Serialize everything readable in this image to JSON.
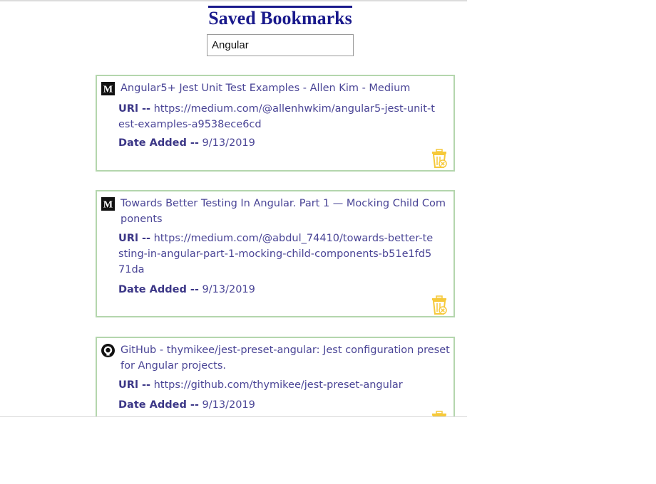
{
  "page": {
    "title": "Saved Bookmarks"
  },
  "search": {
    "value": "Angular"
  },
  "labels": {
    "url": "URl --",
    "date": "Date Added --"
  },
  "colors": {
    "title": "#1a1a8c",
    "text": "#4a4596",
    "card_border": "#b4d6ad",
    "trash": "#f6c93a"
  },
  "bookmarks": [
    {
      "icon": "medium-icon",
      "title": "Angular5+ Jest Unit Test Examples - Allen Kim - Medium",
      "url": "https://medium.com/@allenhwkim/angular5-jest-unit-test-examples-a9538ece6cd",
      "date": "9/13/2019"
    },
    {
      "icon": "medium-icon",
      "title": "Towards Better Testing In Angular. Part 1 — Mocking Child Components",
      "url": "https://medium.com/@abdul_74410/towards-better-testing-in-angular-part-1-mocking-child-components-b51e1fd571da",
      "date": "9/13/2019"
    },
    {
      "icon": "github-icon",
      "title": "GitHub - thymikee/jest-preset-angular: Jest configuration preset for Angular projects.",
      "url": "https://github.com/thymikee/jest-preset-angular",
      "date": "9/13/2019"
    }
  ]
}
